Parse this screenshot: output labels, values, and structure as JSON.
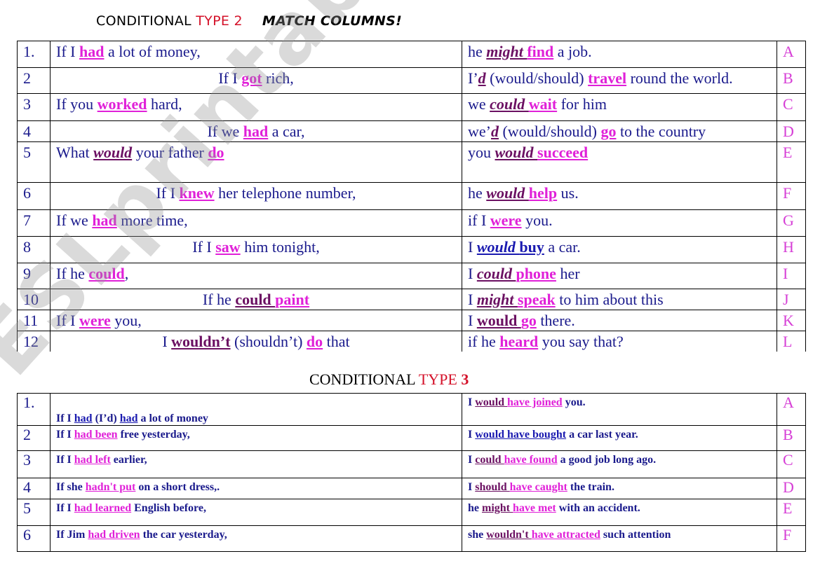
{
  "title1": {
    "prefix": "CONDITIONAL ",
    "type": "TYPE 2",
    "match": "MATCH COLUMNS!"
  },
  "title2": {
    "prefix": "CONDITIONAL ",
    "type": "TYPE ",
    "num": "3"
  },
  "watermark": "ESLprintables.com",
  "colors": {
    "text": "#1a1a8c",
    "pink": "#e020d8",
    "purple": "#6b1062",
    "red": "#d4122a"
  },
  "type2": [
    {
      "num": "1.",
      "align": "left",
      "left": [
        [
          "plain",
          "If I "
        ],
        [
          "pk",
          "had"
        ],
        [
          "plain",
          " a lot of money,"
        ]
      ],
      "right": [
        [
          "plain",
          "he "
        ],
        [
          "pu",
          "might "
        ],
        [
          "pk",
          "find"
        ],
        [
          "plain",
          " a job."
        ]
      ],
      "letter": "A"
    },
    {
      "num": "2",
      "align": "center",
      "left": [
        [
          "plain",
          "If I "
        ],
        [
          "pk",
          "got"
        ],
        [
          "plain",
          " rich,"
        ]
      ],
      "right": [
        [
          "plain",
          "I’"
        ],
        [
          "pu",
          "d"
        ],
        [
          "plain",
          " (would/should) "
        ],
        [
          "pk",
          "travel"
        ],
        [
          "plain",
          " round the world."
        ]
      ],
      "letter": "B"
    },
    {
      "num": "3",
      "align": "left",
      "left": [
        [
          "plain",
          "If you "
        ],
        [
          "pk",
          "worked"
        ],
        [
          "plain",
          " hard,"
        ]
      ],
      "right": [
        [
          "plain",
          "we "
        ],
        [
          "pu",
          "could "
        ],
        [
          "pk",
          "wait"
        ],
        [
          "plain",
          " for him"
        ]
      ],
      "letter": "C"
    },
    {
      "num": "4",
      "align": "center",
      "left": [
        [
          "plain",
          "If we "
        ],
        [
          "pk",
          "had"
        ],
        [
          "plain",
          " a car,"
        ]
      ],
      "right": [
        [
          "plain",
          "we’"
        ],
        [
          "pu",
          "d"
        ],
        [
          "plain",
          " (would/should) "
        ],
        [
          "pk",
          "go"
        ],
        [
          "plain",
          " to the country"
        ]
      ],
      "letter": "D"
    },
    {
      "num": "5",
      "align": "left",
      "left": [
        [
          "plain",
          "What "
        ],
        [
          "pu",
          "would"
        ],
        [
          "plain",
          " your father "
        ],
        [
          "pk",
          "do"
        ]
      ],
      "right": [
        [
          "plain",
          "you "
        ],
        [
          "pu",
          "would "
        ],
        [
          "pk",
          "succeed"
        ]
      ],
      "letter": "E"
    },
    {
      "num": "6",
      "align": "center",
      "left": [
        [
          "plain",
          "If I "
        ],
        [
          "pk",
          "knew"
        ],
        [
          "plain",
          " her telephone number,"
        ]
      ],
      "right": [
        [
          "plain",
          "he "
        ],
        [
          "pu",
          "would "
        ],
        [
          "pk",
          "help"
        ],
        [
          "plain",
          " us."
        ]
      ],
      "letter": "F"
    },
    {
      "num": "7",
      "align": "left",
      "left": [
        [
          "plain",
          "If we "
        ],
        [
          "pk",
          "had"
        ],
        [
          "plain",
          " more time,"
        ]
      ],
      "right": [
        [
          "plain",
          "if I "
        ],
        [
          "pk",
          "were"
        ],
        [
          "plain",
          " you."
        ]
      ],
      "letter": "G"
    },
    {
      "num": "8",
      "align": "center",
      "left": [
        [
          "plain",
          "If I "
        ],
        [
          "pk",
          "saw"
        ],
        [
          "plain",
          " him tonight,"
        ]
      ],
      "right": [
        [
          "plain",
          "I "
        ],
        [
          "bli",
          "would "
        ],
        [
          "bl",
          "buy"
        ],
        [
          "plain",
          " a car."
        ]
      ],
      "letter": "H"
    },
    {
      "num": "9",
      "align": "left",
      "left": [
        [
          "plain",
          "If he "
        ],
        [
          "pk",
          "could"
        ],
        [
          "plain",
          ","
        ]
      ],
      "right": [
        [
          "plain",
          "I "
        ],
        [
          "pu",
          "could "
        ],
        [
          "pk",
          "phone"
        ],
        [
          "plain",
          " her"
        ]
      ],
      "letter": "I"
    },
    {
      "num": "10",
      "align": "center",
      "left": [
        [
          "plain",
          "If he "
        ],
        [
          "pub",
          "could "
        ],
        [
          "pk",
          "paint"
        ]
      ],
      "right": [
        [
          "plain",
          "I "
        ],
        [
          "pu",
          "might "
        ],
        [
          "pk",
          "speak"
        ],
        [
          "plain",
          " to him about this"
        ]
      ],
      "letter": "J"
    },
    {
      "num": "11",
      "align": "left",
      "left": [
        [
          "plain",
          "If I "
        ],
        [
          "pk",
          "were"
        ],
        [
          "plain",
          " you,"
        ]
      ],
      "right": [
        [
          "plain",
          "I "
        ],
        [
          "pub",
          "would "
        ],
        [
          "pk",
          "go"
        ],
        [
          "plain",
          " there."
        ]
      ],
      "letter": "K"
    },
    {
      "num": "12",
      "align": "center",
      "left": [
        [
          "plain",
          "I "
        ],
        [
          "pub",
          "wouldn’t"
        ],
        [
          "plain",
          " (shouldn’t)  "
        ],
        [
          "pk",
          "do"
        ],
        [
          "plain",
          " that"
        ]
      ],
      "right": [
        [
          "plain",
          "if he "
        ],
        [
          "pk",
          "heard"
        ],
        [
          "plain",
          " you say that?"
        ]
      ],
      "letter": "L"
    }
  ],
  "type3": [
    {
      "num": "1.",
      "left": [
        [
          "plain",
          "If I "
        ],
        [
          "bl",
          "had"
        ],
        [
          "plain",
          " (I’d) "
        ],
        [
          "bl",
          "had"
        ],
        [
          "plain",
          " a lot of money"
        ]
      ],
      "right": [
        [
          "plain",
          "I "
        ],
        [
          "pub",
          "would "
        ],
        [
          "pk",
          "have joined"
        ],
        [
          "plain",
          " you."
        ]
      ],
      "letter": "A"
    },
    {
      "num": "2",
      "left": [
        [
          "plain",
          "If I "
        ],
        [
          "pk",
          "had been"
        ],
        [
          "plain",
          " free yesterday,"
        ]
      ],
      "right": [
        [
          "plain",
          "I "
        ],
        [
          "bl",
          "would have bought"
        ],
        [
          "plain",
          " a car last year."
        ]
      ],
      "letter": "B"
    },
    {
      "num": "3",
      "left": [
        [
          "plain",
          "If I "
        ],
        [
          "pk",
          "had left"
        ],
        [
          "plain",
          " earlier,"
        ]
      ],
      "right": [
        [
          "plain",
          "I "
        ],
        [
          "pub",
          "could "
        ],
        [
          "pk",
          "have found"
        ],
        [
          "plain",
          " a good job long ago."
        ]
      ],
      "letter": "C"
    },
    {
      "num": "4",
      "left": [
        [
          "plain",
          "If she "
        ],
        [
          "pk",
          "hadn't put"
        ],
        [
          "plain",
          " on a short dress,."
        ]
      ],
      "right": [
        [
          "plain",
          "I "
        ],
        [
          "pub",
          "should "
        ],
        [
          "pk",
          "have caught"
        ],
        [
          "plain",
          " the train."
        ]
      ],
      "letter": "D"
    },
    {
      "num": "5",
      "left": [
        [
          "plain",
          "If I "
        ],
        [
          "pk",
          "had learned"
        ],
        [
          "plain",
          " English before,"
        ]
      ],
      "right": [
        [
          "plain",
          "he "
        ],
        [
          "pub",
          "might "
        ],
        [
          "pk",
          "have met"
        ],
        [
          "plain",
          " with an accident."
        ]
      ],
      "letter": "E"
    },
    {
      "num": "6",
      "left": [
        [
          "plain",
          "If Jim "
        ],
        [
          "pk",
          "had driven"
        ],
        [
          "plain",
          " the car yesterday,"
        ]
      ],
      "right": [
        [
          "plain",
          "she "
        ],
        [
          "pub",
          "wouldn't "
        ],
        [
          "pk",
          "have attracted"
        ],
        [
          "plain",
          " such attention"
        ]
      ],
      "letter": "F"
    }
  ]
}
